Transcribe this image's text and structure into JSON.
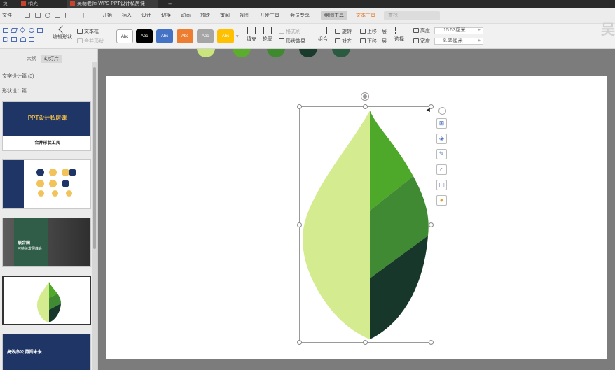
{
  "titlebar": {
    "tabs": [
      {
        "label": "负"
      },
      {
        "label": "稍壳"
      },
      {
        "label": "吴萌老师-WPS PPT设计私房课"
      }
    ],
    "new_tab": "+"
  },
  "menubar": {
    "file": "文件",
    "items": [
      "开始",
      "插入",
      "设计",
      "切换",
      "动画",
      "放映",
      "审阅",
      "视图",
      "开发工具",
      "会员专享"
    ],
    "drawing_tools": "绘图工具",
    "text_tools": "文本工具",
    "search_placeholder": "查找"
  },
  "ribbon": {
    "edit_shape": "编辑形状",
    "text_box": "文本框",
    "merge_shapes": "合并形状",
    "style_label": "Abc",
    "style_colors": [
      "#ffffff",
      "#000000",
      "#4472c4",
      "#ed7d31",
      "#a5a5a5",
      "#ffc000"
    ],
    "fill": "填充",
    "outline": "轮廓",
    "shape_effects": "形状效果",
    "format_painter": "格式刷",
    "combine": "组合",
    "rotate": "旋转",
    "align": "对齐",
    "bring_forward": "上移一层",
    "send_backward": "下移一层",
    "select": "选择",
    "height_label": "高度",
    "height_value": "15.53厘米",
    "width_label": "宽度",
    "width_value": "8.55厘米",
    "logo_char": "吴"
  },
  "palette_circles": [
    "#c9e57c",
    "#5aae2b",
    "#3f8a2f",
    "#1a3b2c",
    "#2a5a40"
  ],
  "sidebar": {
    "tab_outline": "大纲",
    "tab_slides": "幻灯片",
    "section1": "文字设计篇 (3)",
    "section2": "形状设计篇",
    "slide1": {
      "title": "PPT设计私房课",
      "subtitle": "合并形状工具"
    },
    "slide3": {
      "title": "联合国",
      "subtitle": "可持续发展峰会"
    },
    "slide5": {
      "title": "高效办公 勇闯未来"
    }
  },
  "leaf": {
    "colors": {
      "light": "#d4ec8f",
      "mid1": "#4ea82a",
      "mid2": "#3f8a32",
      "dark": "#17372b"
    }
  },
  "side_tools": [
    "layout-icon",
    "layers-icon",
    "pen-icon",
    "eraser-icon",
    "frame-icon",
    "bulb-icon"
  ]
}
